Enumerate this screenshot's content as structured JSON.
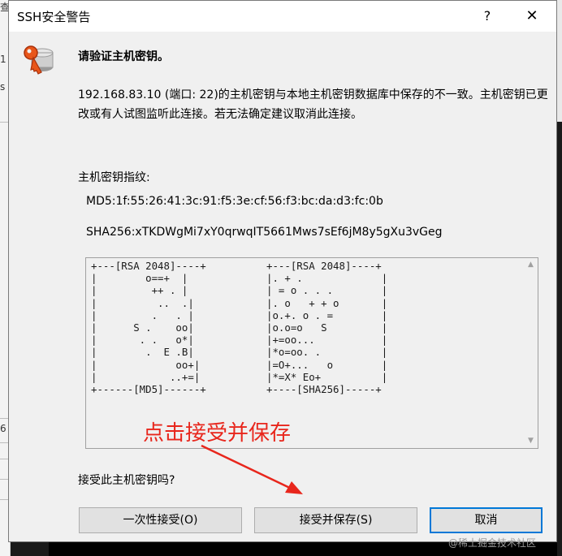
{
  "background": {
    "left_fragments": [
      "查",
      "1",
      "s",
      "6"
    ]
  },
  "dialog": {
    "title": "SSH安全警告",
    "help_glyph": "?",
    "close_glyph": "✕",
    "heading": "请验证主机密钥。",
    "message": "192.168.83.10 (端口: 22)的主机密钥与本地主机密钥数据库中保存的不一致。主机密钥已更改或有人试图监听此连接。若无法确定建议取消此连接。",
    "fingerprint_label": "主机密钥指纹:",
    "md5": "MD5:1f:55:26:41:3c:91:f5:3e:cf:56:f3:bc:da:d3:fc:0b",
    "sha256": "SHA256:xTKDWgMi7xY0qrwqIT5661Mws7sEf6jM8y5gXu3vGeg",
    "randomart_md5": "+---[RSA 2048]----+\n|        o==+  |\n|         ++ . |\n|          ..  .|\n|         .   . |\n|      S .    oo|\n|       . .   o*|\n|        .  E .B|\n|             oo+|\n|            ..+=|\n+------[MD5]------+",
    "randomart_sha256": "+---[RSA 2048]----+\n|. + .             |\n| = o . . .        |\n|. o   + + o       |\n|o.+. o . =        |\n|o.o=o   S         |\n|+=oo...           |\n|*o=oo. .          |\n|=O+...   o        |\n|*=X* Eo+          |\n+----[SHA256]-----+",
    "annotation": "点击接受并保存",
    "question": "接受此主机密钥吗?",
    "buttons": {
      "accept_once": "一次性接受(O)",
      "accept_save": "接受并保存(S)",
      "cancel": "取消"
    },
    "scroll_up_glyph": "▲",
    "scroll_down_glyph": "▼"
  },
  "watermark": "@稀土掘金技术社区",
  "colors": {
    "annotation": "#e8261c",
    "default_button_border": "#0078d7"
  }
}
